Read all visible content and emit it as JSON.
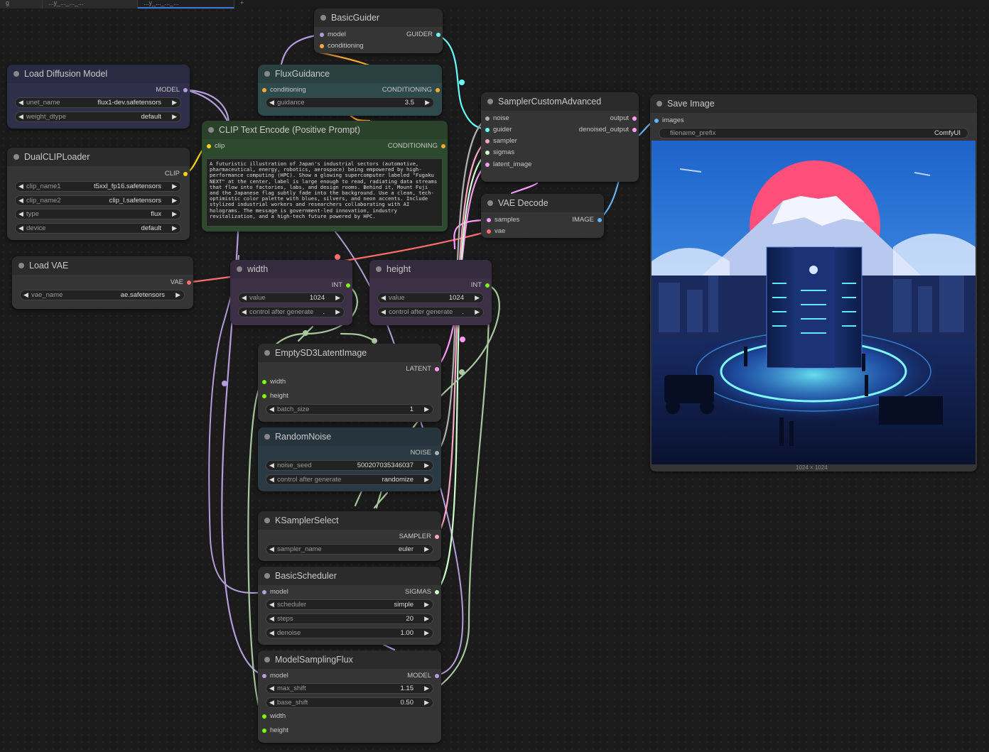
{
  "tabs": [
    {
      "label": "g"
    },
    {
      "label": "...y_..._..._..."
    },
    {
      "label": "...y_..._..._..."
    },
    {
      "label": "+"
    }
  ],
  "colors": {
    "model": "#b39ddb",
    "clip": "#ffd500",
    "vae": "#ff6e6e",
    "conditioning": "#ffa931",
    "latent": "#ff9cf9",
    "image": "#64b5f6",
    "int": "#7cfc00",
    "noise": "#b0b0b0",
    "guider": "#66ffff",
    "sampler": "#ffa6c9",
    "sigmas": "#cdffcd"
  },
  "nodes": {
    "basic_guider": {
      "title": "BasicGuider",
      "in_model": "model",
      "in_conditioning": "conditioning",
      "out_guider": "GUIDER"
    },
    "load_diffusion": {
      "title": "Load Diffusion Model",
      "out_model": "MODEL",
      "unet_name_label": "unet_name",
      "unet_name_value": "flux1-dev.safetensors",
      "weight_dtype_label": "weight_dtype",
      "weight_dtype_value": "default"
    },
    "flux_guidance": {
      "title": "FluxGuidance",
      "in_conditioning": "conditioning",
      "out_conditioning": "CONDITIONING",
      "guidance_label": "guidance",
      "guidance_value": "3.5"
    },
    "sampler_custom": {
      "title": "SamplerCustomAdvanced",
      "in_noise": "noise",
      "in_guider": "guider",
      "in_sampler": "sampler",
      "in_sigmas": "sigmas",
      "in_latent": "latent_image",
      "out_output": "output",
      "out_denoised": "denoised_output"
    },
    "save_image": {
      "title": "Save Image",
      "in_images": "images",
      "filename_label": "filename_prefix",
      "filename_value": "ComfyUI",
      "image_size": "1024 × 1024"
    },
    "dual_clip": {
      "title": "DualCLIPLoader",
      "out_clip": "CLIP",
      "clip1_label": "clip_name1",
      "clip1_value": "t5xxl_fp16.safetensors",
      "clip2_label": "clip_name2",
      "clip2_value": "clip_l.safetensors",
      "type_label": "type",
      "type_value": "flux",
      "device_label": "device",
      "device_value": "default"
    },
    "clip_text": {
      "title": "CLIP Text Encode (Positive Prompt)",
      "in_clip": "clip",
      "out_conditioning": "CONDITIONING",
      "prompt": "A futuristic illustration of Japan's industrial sectors (automotive, pharmaceutical, energy, robotics, aerospace) being empowered by high-performance computing (HPC). Show a glowing supercomputer labeled \"Fugaku NEXT\" at the center, label is large enough to read, radiating data streams that flow into factories, labs, and design rooms. Behind it, Mount Fuji and the Japanese flag subtly fade into the background. Use a clean, tech-optimistic color palette with blues, silvers, and neon accents. Include stylized industrial workers and researchers collaborating with AI holograms. The message is government-led innovation, industry revitalization, and a high-tech future powered by HPC."
    },
    "vae_decode": {
      "title": "VAE Decode",
      "in_samples": "samples",
      "in_vae": "vae",
      "out_image": "IMAGE"
    },
    "load_vae": {
      "title": "Load VAE",
      "out_vae": "VAE",
      "vae_name_label": "vae_name",
      "vae_name_value": "ae.safetensors"
    },
    "width": {
      "title": "width",
      "out_int": "INT",
      "value_label": "value",
      "value_value": "1024",
      "cag_label": "control after generate",
      "cag_value": "."
    },
    "height": {
      "title": "height",
      "out_int": "INT",
      "value_label": "value",
      "value_value": "1024",
      "cag_label": "control after generate",
      "cag_value": "."
    },
    "empty_latent": {
      "title": "EmptySD3LatentImage",
      "out_latent": "LATENT",
      "in_width": "width",
      "in_height": "height",
      "batch_label": "batch_size",
      "batch_value": "1"
    },
    "random_noise": {
      "title": "RandomNoise",
      "out_noise": "NOISE",
      "seed_label": "noise_seed",
      "seed_value": "500207035346037",
      "cag_label": "control after generate",
      "cag_value": "randomize"
    },
    "ksampler_select": {
      "title": "KSamplerSelect",
      "out_sampler": "SAMPLER",
      "sampler_label": "sampler_name",
      "sampler_value": "euler"
    },
    "basic_scheduler": {
      "title": "BasicScheduler",
      "in_model": "model",
      "out_sigmas": "SIGMAS",
      "scheduler_label": "scheduler",
      "scheduler_value": "simple",
      "steps_label": "steps",
      "steps_value": "20",
      "denoise_label": "denoise",
      "denoise_value": "1.00"
    },
    "model_sampling": {
      "title": "ModelSamplingFlux",
      "in_model": "model",
      "out_model": "MODEL",
      "max_shift_label": "max_shift",
      "max_shift_value": "1.15",
      "base_shift_label": "base_shift",
      "base_shift_value": "0.50",
      "in_width": "width",
      "in_height": "height"
    }
  },
  "generated_image": {
    "fugaku_label": "",
    "subject": "fugaku-next-supercomputer"
  }
}
